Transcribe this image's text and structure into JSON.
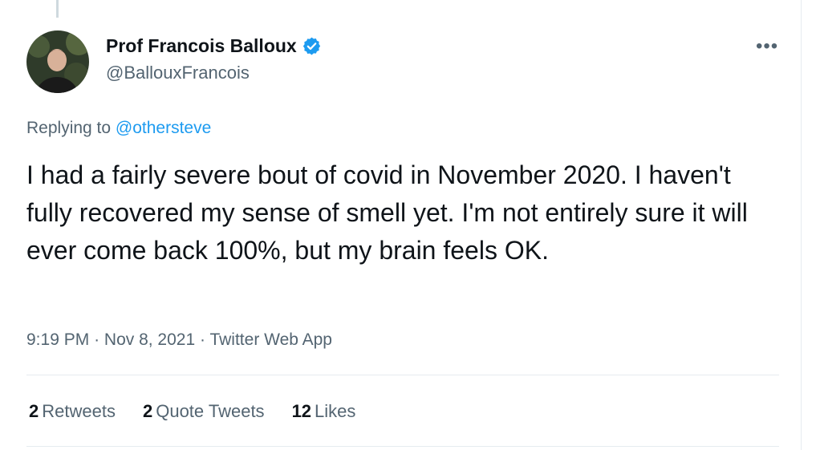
{
  "author": {
    "display_name": "Prof Francois Balloux",
    "handle": "@BallouxFrancois",
    "verified": true
  },
  "more_icon": "more-options-icon",
  "reply": {
    "prefix": "Replying to",
    "mention": "@othersteve"
  },
  "tweet": {
    "text": "I had a fairly severe bout of covid in November 2020. I haven't fully recovered my sense of smell yet. I'm not entirely sure it will ever come back 100%, but my brain feels OK."
  },
  "meta": {
    "time": "9:19 PM",
    "separator": "·",
    "date": "Nov 8, 2021",
    "source": "Twitter Web App"
  },
  "stats": [
    {
      "count": "2",
      "label": "Retweets"
    },
    {
      "count": "2",
      "label": "Quote Tweets"
    },
    {
      "count": "12",
      "label": "Likes"
    }
  ],
  "colors": {
    "accent": "#1d9bf0",
    "secondary_text": "#536471",
    "primary_text": "#0f1419"
  }
}
